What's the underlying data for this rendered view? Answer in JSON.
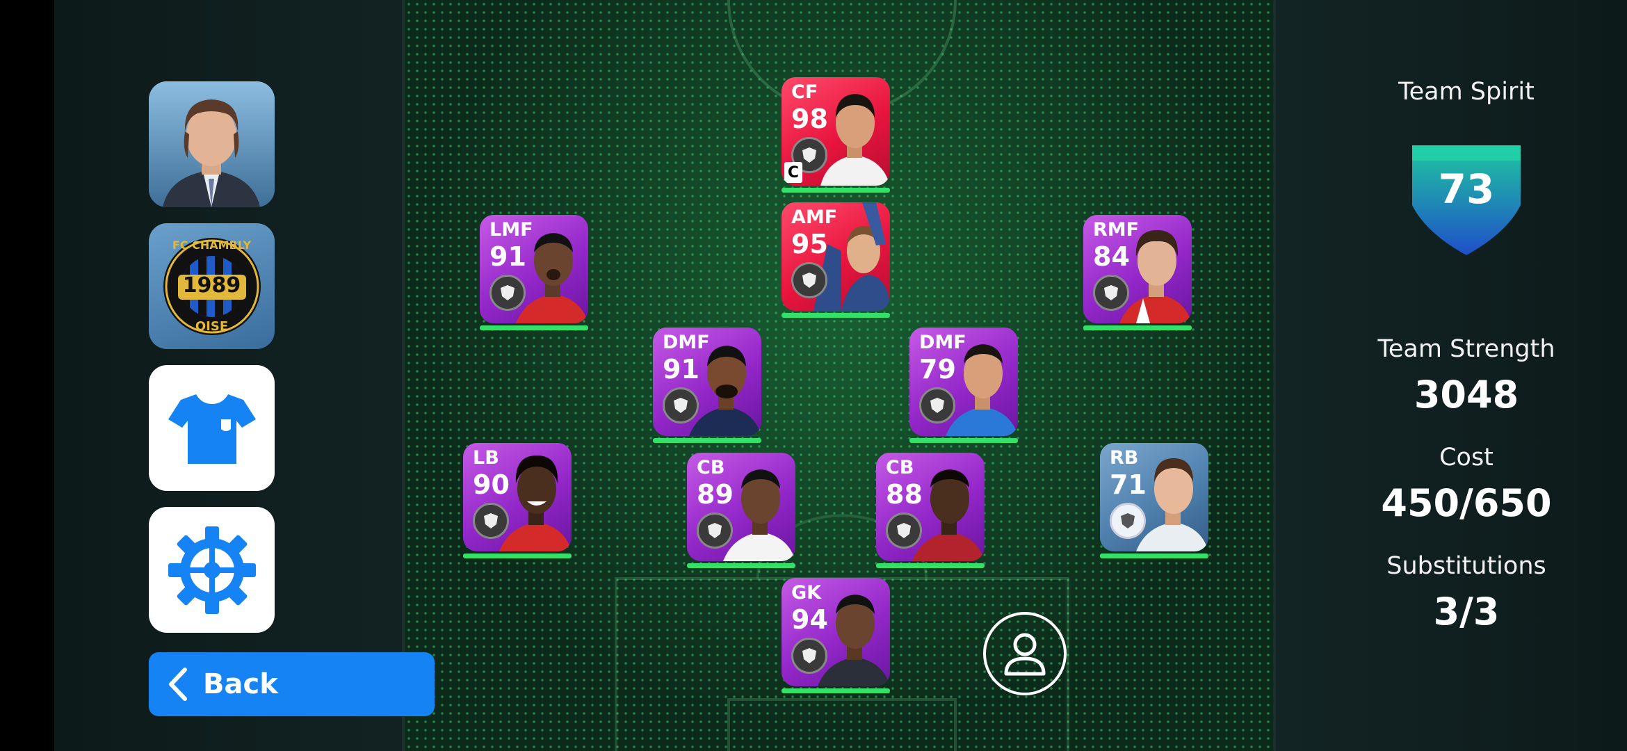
{
  "sidebar": {
    "manager_label": "Manager",
    "club": {
      "crest_top": "FC CHAMBLY",
      "crest_year": "1989",
      "crest_bottom": "OISE"
    },
    "back_label": "Back"
  },
  "players": [
    {
      "position": "CF",
      "rating": "98",
      "color": "red",
      "captain": "C"
    },
    {
      "position": "LMF",
      "rating": "91",
      "color": "purple"
    },
    {
      "position": "AMF",
      "rating": "95",
      "color": "red"
    },
    {
      "position": "RMF",
      "rating": "84",
      "color": "purple"
    },
    {
      "position": "DMF",
      "rating": "91",
      "color": "purple"
    },
    {
      "position": "DMF",
      "rating": "79",
      "color": "purple"
    },
    {
      "position": "LB",
      "rating": "90",
      "color": "purple"
    },
    {
      "position": "CB",
      "rating": "89",
      "color": "purple"
    },
    {
      "position": "CB",
      "rating": "88",
      "color": "purple"
    },
    {
      "position": "RB",
      "rating": "71",
      "color": "blue"
    },
    {
      "position": "GK",
      "rating": "94",
      "color": "purple"
    }
  ],
  "stats": {
    "team_spirit_label": "Team Spirit",
    "team_spirit_value": "73",
    "team_strength_label": "Team Strength",
    "team_strength_value": "3048",
    "cost_label": "Cost",
    "cost_value": "450/650",
    "substitutions_label": "Substitutions",
    "substitutions_value": "3/3"
  },
  "colors": {
    "accent_blue": "#1683f5",
    "stamina_green": "#34e06a",
    "card_red": "#e8153e",
    "card_purple": "#9327c9",
    "card_blue": "#4f80ae",
    "shield_top": "#1fc7a0",
    "shield_bottom": "#1f5cc9"
  }
}
